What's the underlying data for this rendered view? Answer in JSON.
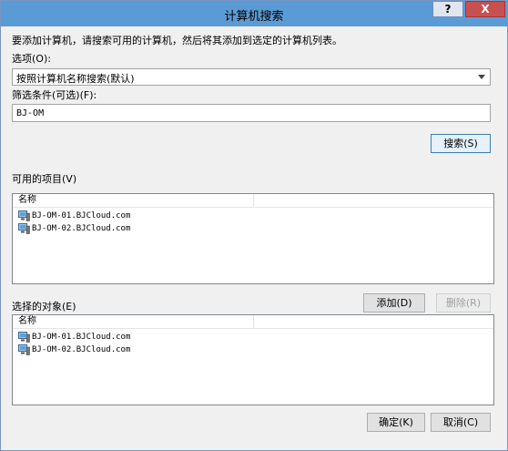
{
  "window": {
    "title": "计算机搜索"
  },
  "controls": {
    "help": "?",
    "close": "X"
  },
  "instruction": "要添加计算机，请搜索可用的计算机，然后将其添加到选定的计算机列表。",
  "options": {
    "label": "选项(O):",
    "selected": "按照计算机名称搜索(默认)"
  },
  "filter": {
    "label": "筛选条件(可选)(F):",
    "value": "BJ-OM"
  },
  "search_button": "搜索(S)",
  "available": {
    "label": "可用的项目(V)",
    "column": "名称",
    "items": [
      "BJ-OM-01.BJCloud.com",
      "BJ-OM-02.BJCloud.com"
    ]
  },
  "selected": {
    "label": "选择的对象(E)",
    "column": "名称",
    "items": [
      "BJ-OM-01.BJCloud.com",
      "BJ-OM-02.BJCloud.com"
    ]
  },
  "add_button": "添加(D)",
  "remove_button": "删除(R)",
  "ok_button": "确定(K)",
  "cancel_button": "取消(C)"
}
